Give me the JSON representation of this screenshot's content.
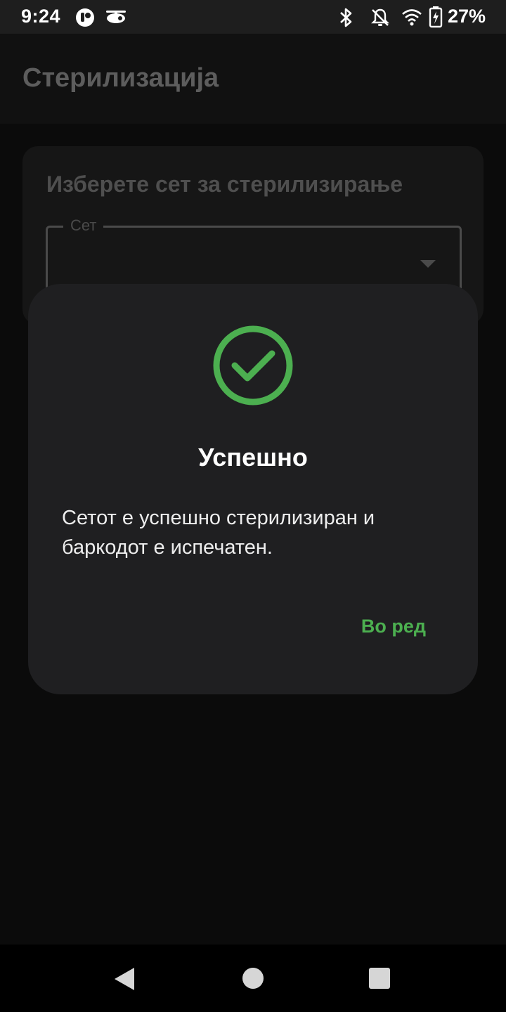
{
  "status_bar": {
    "time": "9:24",
    "battery_percent": "27%",
    "icons": [
      "app-notification-icon",
      "drone-icon",
      "bluetooth-icon",
      "do-not-disturb-off-icon",
      "wifi-icon",
      "battery-charging-icon"
    ]
  },
  "app_bar": {
    "title": "Стерилизација"
  },
  "form": {
    "heading": "Изберете сет за стерилизирање",
    "set_field_label": "Сет",
    "set_field_value": ""
  },
  "dialog": {
    "icon": "check-circle-icon",
    "title": "Успешно",
    "message": "Сетот е успешно стерилизиран и баркодот е испечатен.",
    "ok_label": "Во ред"
  },
  "nav_bar": {
    "icons": [
      "back-icon",
      "home-icon",
      "recents-icon"
    ]
  },
  "colors": {
    "success": "#4caf50",
    "dialog_background": "#1f1f21",
    "scrim_background": "#0b0b0b"
  }
}
